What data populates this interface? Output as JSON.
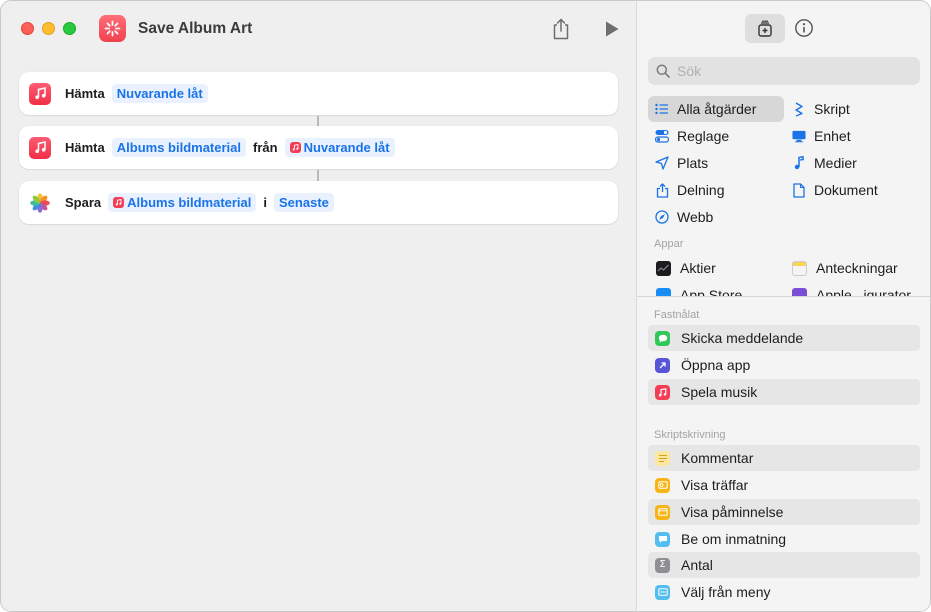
{
  "window": {
    "title": "Save Album Art"
  },
  "colors": {
    "accent": "#1a73e8",
    "token_bg": "#e8f1fd",
    "music_red": "#f43e55",
    "app_icon": "#f0434f"
  },
  "actions": [
    {
      "verb": "Hämta",
      "token1": "Nuvarande låt"
    },
    {
      "verb": "Hämta",
      "token1": "Albums bildmaterial",
      "connector": "från",
      "token2": "Nuvarande låt"
    },
    {
      "verb": "Spara",
      "token1": "Albums bildmaterial",
      "connector": "i",
      "token2": "Senaste"
    }
  ],
  "sidebar": {
    "search_placeholder": "Sök",
    "categories": [
      {
        "label": "Alla åtgärder",
        "icon": "list-icon",
        "selected": true
      },
      {
        "label": "Skript",
        "icon": "script-icon"
      },
      {
        "label": "Reglage",
        "icon": "toggle-icon"
      },
      {
        "label": "Enhet",
        "icon": "display-icon"
      },
      {
        "label": "Plats",
        "icon": "location-arrow-icon"
      },
      {
        "label": "Medier",
        "icon": "music-note-icon"
      },
      {
        "label": "Delning",
        "icon": "share-icon"
      },
      {
        "label": "Dokument",
        "icon": "document-icon"
      },
      {
        "label": "Webb",
        "icon": "compass-icon"
      }
    ],
    "apps_header": "Appar",
    "apps": [
      "Aktier",
      "Anteckningar",
      "App Store",
      "Apple...igurator"
    ],
    "pinned_header": "Fastnålat",
    "pinned": [
      "Skicka meddelande",
      "Öppna app",
      "Spela musik"
    ],
    "scripting_header": "Skriptskrivning",
    "scripting": [
      "Kommentar",
      "Visa träffar",
      "Visa påminnelse",
      "Be om inmatning",
      "Antal",
      "Välj från meny"
    ]
  }
}
